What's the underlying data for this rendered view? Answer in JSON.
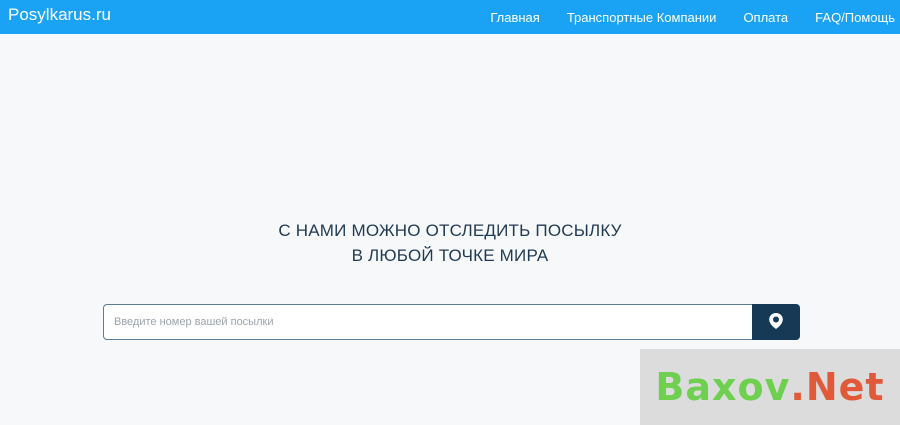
{
  "header": {
    "brand": "Posylkarus.ru",
    "nav": [
      {
        "label": "Главная"
      },
      {
        "label": "Транспортные Компании"
      },
      {
        "label": "Оплата"
      },
      {
        "label": "FAQ/Помощь"
      }
    ]
  },
  "hero": {
    "line1": "С НАМИ МОЖНО ОТСЛЕДИТЬ ПОСЫЛКУ",
    "line2": "В ЛЮБОЙ ТОЧКЕ МИРА"
  },
  "search": {
    "placeholder": "Введите номер вашей посылки",
    "value": "",
    "button_icon": "location-pin-icon"
  },
  "watermark": {
    "text_part1": "Baxov",
    "text_part2": ".Net"
  },
  "colors": {
    "header_bg": "#1aa3f5",
    "button_bg": "#163a56",
    "hero_text": "#1f3a52"
  }
}
